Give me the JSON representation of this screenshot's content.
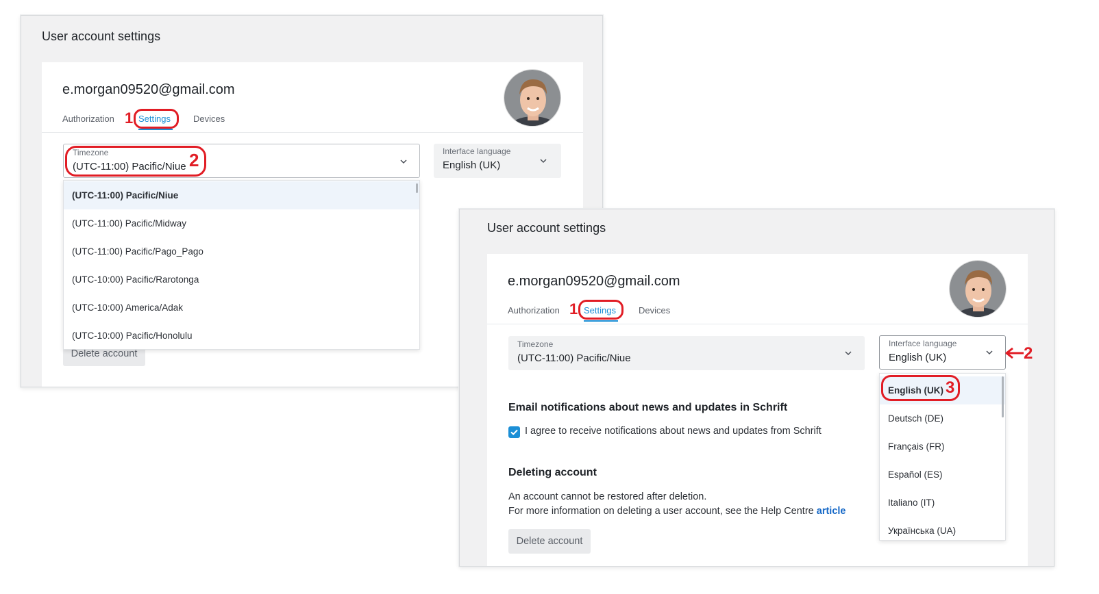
{
  "shots": [
    {
      "title": "User account settings",
      "email": "e.morgan09520@gmail.com",
      "tabs": [
        "Authorization",
        "Settings",
        "Devices"
      ],
      "timezone": {
        "label": "Timezone",
        "value": "(UTC-11:00) Pacific/Niue"
      },
      "language": {
        "label": "Interface language",
        "value": "English (UK)"
      },
      "timezone_options": [
        "(UTC-11:00) Pacific/Niue",
        "(UTC-11:00) Pacific/Midway",
        "(UTC-11:00) Pacific/Pago_Pago",
        "(UTC-10:00) Pacific/Rarotonga",
        "(UTC-10:00) America/Adak",
        "(UTC-10:00) Pacific/Honolulu"
      ],
      "delete_button": "Delete account",
      "markers": [
        "1",
        "2"
      ]
    },
    {
      "title": "User account settings",
      "email": "e.morgan09520@gmail.com",
      "tabs": [
        "Authorization",
        "Settings",
        "Devices"
      ],
      "timezone": {
        "label": "Timezone",
        "value": "(UTC-11:00) Pacific/Niue"
      },
      "language": {
        "label": "Interface language",
        "value": "English (UK)"
      },
      "language_options": [
        "English (UK)",
        "Deutsch (DE)",
        "Français (FR)",
        "Español (ES)",
        "Italiano (IT)",
        "Українська (UA)"
      ],
      "email_section_heading": "Email notifications about news and updates in Schrift",
      "consent_text": "I agree to receive notifications about news and updates from Schrift",
      "consent_checked": true,
      "deleting_heading": "Deleting account",
      "deleting_line1": "An account cannot be restored after deletion.",
      "deleting_line2": "For more information on deleting a user account, see the Help Centre",
      "deleting_link": "article",
      "delete_button": "Delete account",
      "markers": [
        "1",
        "2",
        "3"
      ]
    }
  ],
  "colors": {
    "accent": "#1c8fd6",
    "annotation": "#e11d25",
    "link": "#1769c7",
    "selected_bg": "#eef4fb"
  },
  "icons": [
    "chevron-down-icon",
    "check-icon",
    "arrow-left-icon",
    "avatar-photo"
  ]
}
